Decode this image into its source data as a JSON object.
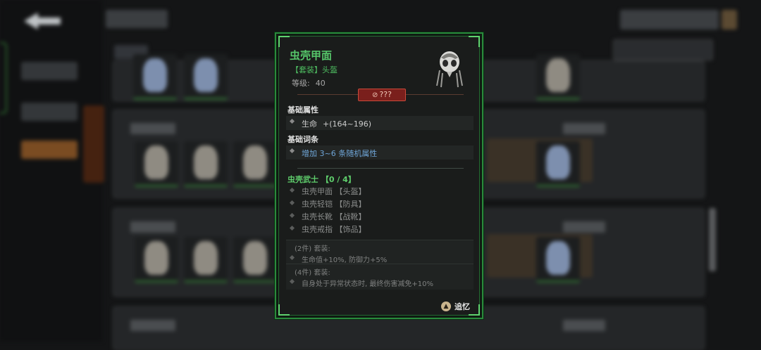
{
  "tooltip": {
    "item_name": "虫壳甲面",
    "item_type": "【套装】头盔",
    "level_label": "等级:",
    "level_value": "40",
    "quality": "???",
    "base_attr_title": "基础属性",
    "base_attr": {
      "name": "生命",
      "value": "+(164~196)"
    },
    "base_affix_title": "基础词条",
    "base_affix": "增加 3~6 条随机属性",
    "set_title": "虫壳武士 【0 / 4】",
    "set_items": [
      "虫壳甲面 【头盔】",
      "虫壳轻铠 【防具】",
      "虫壳长靴 【战靴】",
      "虫壳戒指 【饰品】"
    ],
    "set_bonuses": [
      {
        "title": "(2件) 套装:",
        "desc": "生命值+10%, 防御力+5%"
      },
      {
        "title": "(4件) 套装:",
        "desc": "自身处于异常状态时, 最终伤害减免+10%"
      }
    ],
    "recall_label": "追忆"
  },
  "colors": {
    "set_green": "#56c66a",
    "quality_red": "#7a1f1c",
    "affix_blue": "#6fa6d8",
    "frame_green": "#2a8a3c"
  },
  "icons": [
    "back-arrow-icon",
    "quality-feather-icon",
    "recall-icon",
    "item-portrait-icon"
  ]
}
